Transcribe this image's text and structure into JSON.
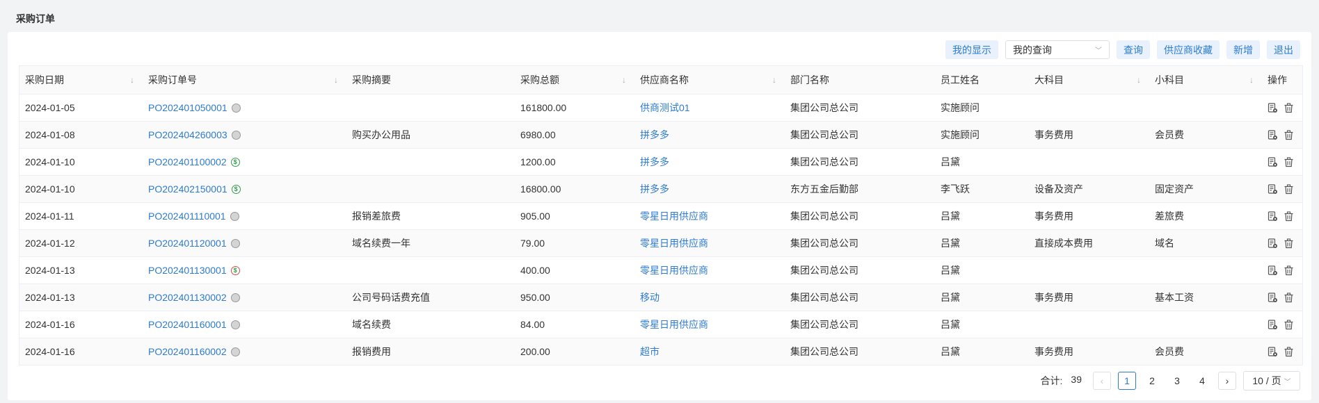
{
  "page": {
    "title": "采购订单"
  },
  "toolbar": {
    "my_display": "我的显示",
    "query_select": "我的查询",
    "query": "查询",
    "supplier_favorites": "供应商收藏",
    "add": "新增",
    "exit": "退出"
  },
  "table": {
    "headers": [
      "采购日期",
      "采购订单号",
      "采购摘要",
      "采购总额",
      "供应商名称",
      "部门名称",
      "员工姓名",
      "大科目",
      "小科目",
      "操作"
    ],
    "rows": [
      {
        "date": "2024-01-05",
        "order_no": "PO202401050001",
        "status": "grey",
        "summary": "",
        "amount": "161800.00",
        "supplier": "供商测试01",
        "department": "集团公司总公司",
        "employee": "实施顾问",
        "major": "",
        "minor": ""
      },
      {
        "date": "2024-01-08",
        "order_no": "PO202404260003",
        "status": "grey",
        "summary": "购买办公用品",
        "amount": "6980.00",
        "supplier": "拼多多",
        "department": "集团公司总公司",
        "employee": "实施顾问",
        "major": "事务费用",
        "minor": "会员费"
      },
      {
        "date": "2024-01-10",
        "order_no": "PO202401100002",
        "status": "paid",
        "summary": "",
        "amount": "1200.00",
        "supplier": "拼多多",
        "department": "集团公司总公司",
        "employee": "吕黛",
        "major": "",
        "minor": ""
      },
      {
        "date": "2024-01-10",
        "order_no": "PO202402150001",
        "status": "paid",
        "summary": "",
        "amount": "16800.00",
        "supplier": "拼多多",
        "department": "东方五金后勤部",
        "employee": "李飞跃",
        "major": "设备及资产",
        "minor": "固定资产"
      },
      {
        "date": "2024-01-11",
        "order_no": "PO202401110001",
        "status": "grey",
        "summary": "报销差旅费",
        "amount": "905.00",
        "supplier": "零星日用供应商",
        "department": "集团公司总公司",
        "employee": "吕黛",
        "major": "事务费用",
        "minor": "差旅费"
      },
      {
        "date": "2024-01-12",
        "order_no": "PO202401120001",
        "status": "grey",
        "summary": "域名续费一年",
        "amount": "79.00",
        "supplier": "零星日用供应商",
        "department": "集团公司总公司",
        "employee": "吕黛",
        "major": "直接成本费用",
        "minor": "域名"
      },
      {
        "date": "2024-01-13",
        "order_no": "PO202401130001",
        "status": "partial",
        "summary": "",
        "amount": "400.00",
        "supplier": "零星日用供应商",
        "department": "集团公司总公司",
        "employee": "吕黛",
        "major": "",
        "minor": ""
      },
      {
        "date": "2024-01-13",
        "order_no": "PO202401130002",
        "status": "grey",
        "summary": "公司号码话费充值",
        "amount": "950.00",
        "supplier": "移动",
        "department": "集团公司总公司",
        "employee": "吕黛",
        "major": "事务费用",
        "minor": "基本工资"
      },
      {
        "date": "2024-01-16",
        "order_no": "PO202401160001",
        "status": "grey",
        "summary": "域名续费",
        "amount": "84.00",
        "supplier": "零星日用供应商",
        "department": "集团公司总公司",
        "employee": "吕黛",
        "major": "",
        "minor": ""
      },
      {
        "date": "2024-01-16",
        "order_no": "PO202401160002",
        "status": "grey",
        "summary": "报销费用",
        "amount": "200.00",
        "supplier": "超市",
        "department": "集团公司总公司",
        "employee": "吕黛",
        "major": "事务费用",
        "minor": "会员费"
      }
    ]
  },
  "pagination": {
    "total_label": "合计:",
    "total": "39",
    "pages": [
      "1",
      "2",
      "3",
      "4"
    ],
    "current": "1",
    "page_size": "10 / 页"
  },
  "icons": {
    "sort": "sort-down-arrow-icon",
    "status_grey": "grey-circle-icon",
    "status_paid": "dollar-circle-icon",
    "edit": "document-edit-icon",
    "delete": "trash-icon"
  },
  "colors": {
    "accent": "#2d7bd2",
    "button_bg": "#e8f1fc",
    "paid_green": "#2e9a4b",
    "partial_red": "#d94b3d"
  }
}
